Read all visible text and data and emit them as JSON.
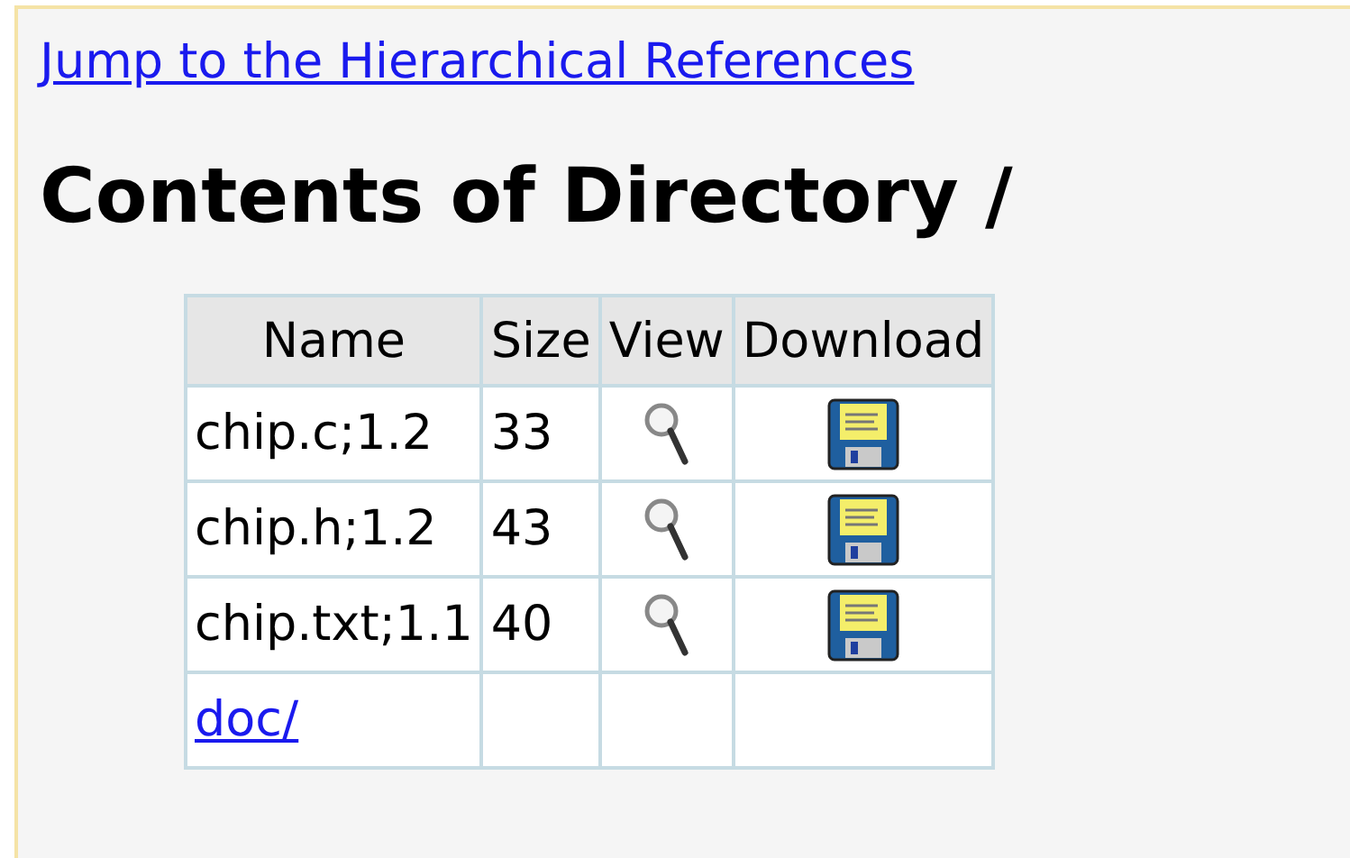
{
  "jump_link": "Jump to the Hierarchical References",
  "heading": "Contents of Directory /",
  "table": {
    "columns": [
      "Name",
      "Size",
      "View",
      "Download"
    ],
    "rows": [
      {
        "kind": "file",
        "name": "chip.c;1.2",
        "size": "33"
      },
      {
        "kind": "file",
        "name": "chip.h;1.2",
        "size": "43"
      },
      {
        "kind": "file",
        "name": "chip.txt;1.1",
        "size": "40"
      },
      {
        "kind": "dir",
        "name": "doc/"
      }
    ]
  }
}
